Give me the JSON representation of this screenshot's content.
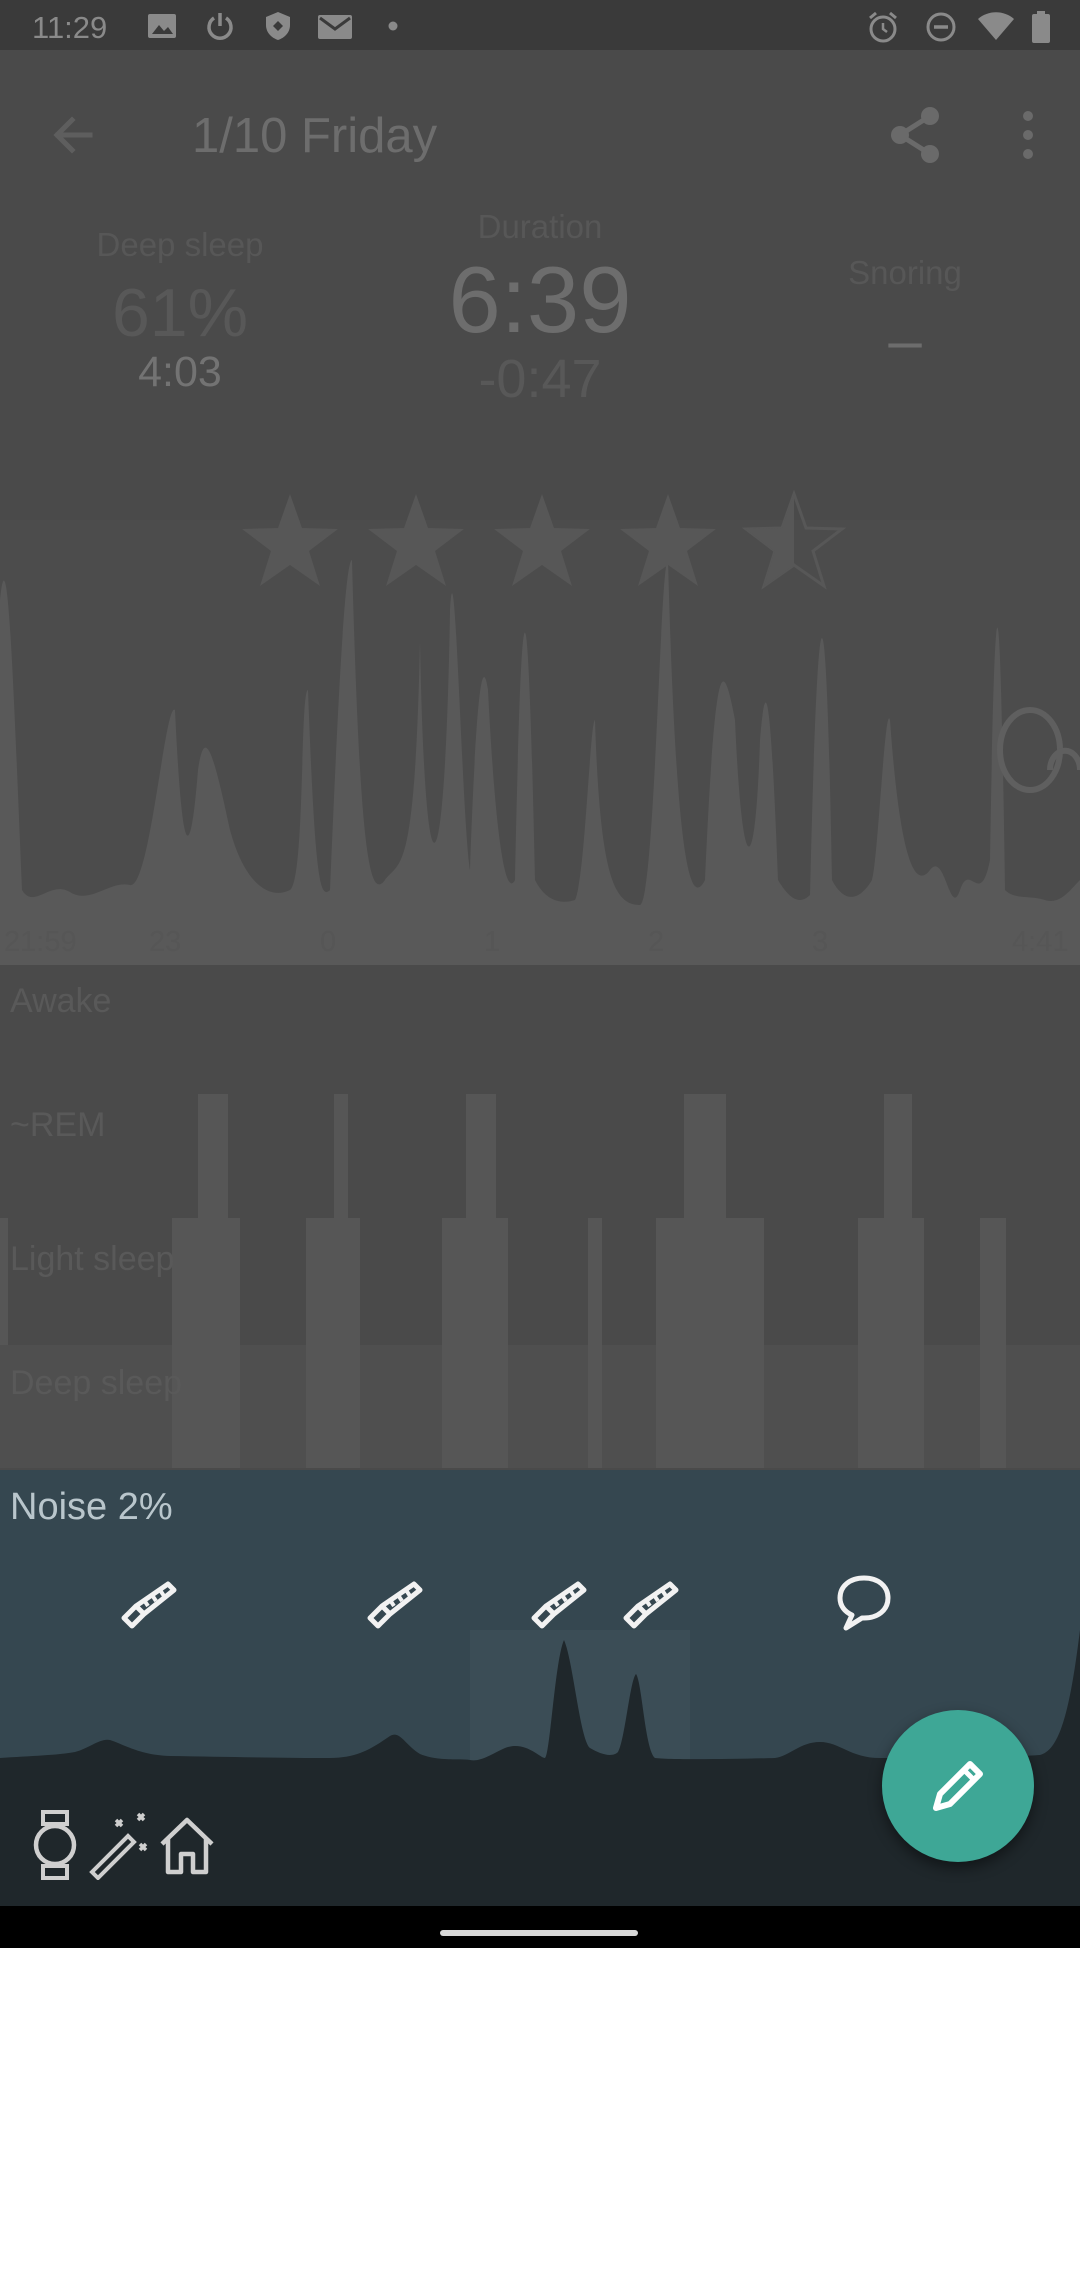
{
  "status_bar": {
    "time": "11:29"
  },
  "app_bar": {
    "title": "1/10 Friday"
  },
  "stats": {
    "deep_sleep": {
      "label": "Deep sleep",
      "percent": "61%",
      "time": "4:03"
    },
    "duration": {
      "label": "Duration",
      "value": "6:39",
      "diff": "-0:47"
    },
    "snoring": {
      "label": "Snoring",
      "value": "–"
    }
  },
  "rating": {
    "stars": 4.5,
    "max": 5
  },
  "graph": {
    "hour_labels": [
      "21:59",
      "23",
      "0",
      "1",
      "2",
      "3",
      "4:41"
    ]
  },
  "hypnogram": {
    "labels": [
      "Awake",
      "~REM",
      "Light sleep",
      "Deep sleep"
    ]
  },
  "noise": {
    "title": "Noise 2%"
  },
  "icons": {
    "events": [
      "saw-icon",
      "saw-icon",
      "saw-icon",
      "saw-icon",
      "speech-bubble-icon"
    ],
    "bottom": [
      "watch-icon",
      "magic-wand-icon",
      "home-icon"
    ],
    "fab": "edit-pencil-icon"
  },
  "colors": {
    "fab": "#3ea796",
    "noise_panel": "#354750",
    "overlay": "#4a4a4a"
  }
}
